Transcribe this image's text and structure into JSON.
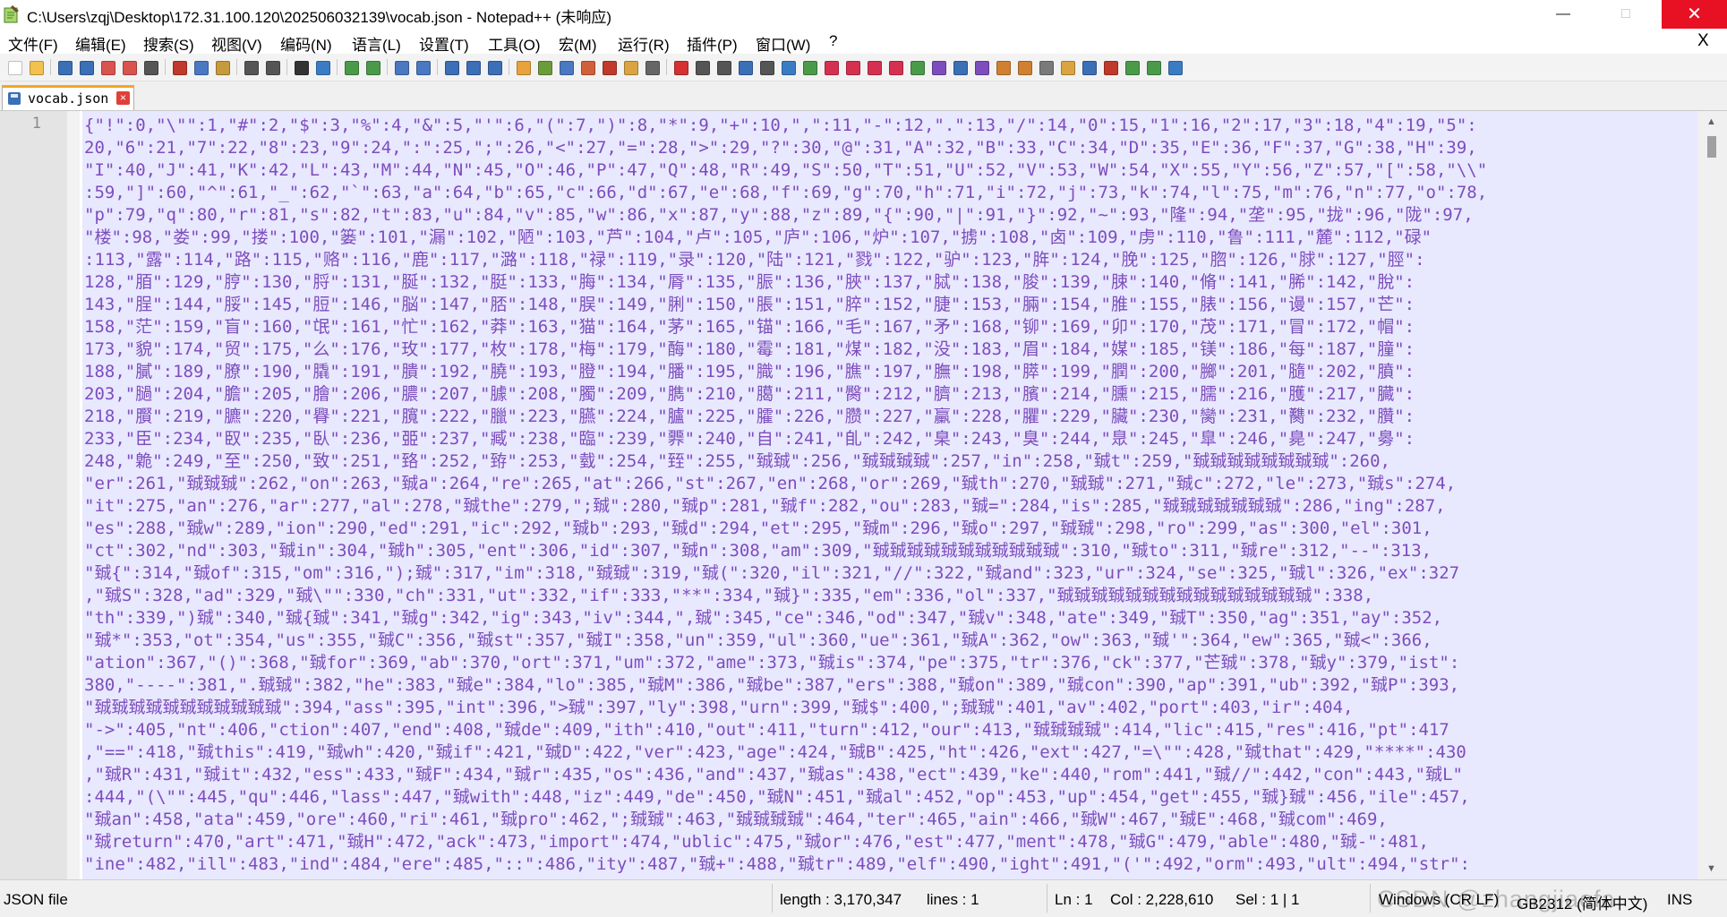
{
  "window": {
    "title": "C:\\Users\\zqj\\Desktop\\172.31.100.120\\202506032139\\vocab.json - Notepad++ (未响应)",
    "minimize_label": "—",
    "maximize_label": "□",
    "close_label": "✕"
  },
  "menu": {
    "items": [
      "文件(F)",
      "编辑(E)",
      "搜索(S)",
      "视图(V)",
      "编码(N)",
      "语言(L)",
      "设置(T)",
      "工具(O)",
      "宏(M)",
      "运行(R)",
      "插件(P)",
      "窗口(W)",
      "?"
    ],
    "close_doc_label": "X"
  },
  "toolbar": {
    "icons": [
      {
        "name": "new-file-icon",
        "color": "#ffffff"
      },
      {
        "name": "open-file-icon",
        "color": "#f2c14e"
      },
      {
        "name": "save-icon",
        "color": "#3b6fb6"
      },
      {
        "name": "save-all-icon",
        "color": "#3b6fb6"
      },
      {
        "name": "close-icon",
        "color": "#d9534f"
      },
      {
        "name": "close-all-icon",
        "color": "#d9534f"
      },
      {
        "name": "print-icon",
        "color": "#555555"
      },
      {
        "name": "cut-icon",
        "color": "#c0392b"
      },
      {
        "name": "copy-icon",
        "color": "#4a78c2"
      },
      {
        "name": "paste-icon",
        "color": "#c79a3b"
      },
      {
        "name": "undo-icon",
        "color": "#555555"
      },
      {
        "name": "redo-icon",
        "color": "#555555"
      },
      {
        "name": "find-icon",
        "color": "#333333"
      },
      {
        "name": "replace-icon",
        "color": "#3a7cc4"
      },
      {
        "name": "zoom-in-icon",
        "color": "#4a9a4a"
      },
      {
        "name": "zoom-out-icon",
        "color": "#4a9a4a"
      },
      {
        "name": "sync-vertical-icon",
        "color": "#4a78c2"
      },
      {
        "name": "sync-horizontal-icon",
        "color": "#4a78c2"
      },
      {
        "name": "word-wrap-icon",
        "color": "#3b6fb6"
      },
      {
        "name": "show-all-chars-icon",
        "color": "#3b6fb6"
      },
      {
        "name": "indent-guide-icon",
        "color": "#3b6fb6"
      },
      {
        "name": "user-lang-icon",
        "color": "#e8a33c"
      },
      {
        "name": "doc-map-icon",
        "color": "#6a9c3a"
      },
      {
        "name": "function-list-icon",
        "color": "#4a78c2"
      },
      {
        "name": "folder-workspace-icon",
        "color": "#d0603a"
      },
      {
        "name": "monitor-icon",
        "color": "#c0392b"
      },
      {
        "name": "open-folder-icon",
        "color": "#d9a441"
      },
      {
        "name": "eye-icon",
        "color": "#666666"
      },
      {
        "name": "record-macro-icon",
        "color": "#d63030"
      },
      {
        "name": "stop-macro-icon",
        "color": "#555555"
      },
      {
        "name": "play-macro-icon",
        "color": "#555555"
      },
      {
        "name": "run-macro-multiple-icon",
        "color": "#3b6fb6"
      },
      {
        "name": "save-macro-icon",
        "color": "#555555"
      },
      {
        "name": "plugin-a-icon",
        "color": "#3a7cc4"
      },
      {
        "name": "plugin-b-icon",
        "color": "#4a9a4a"
      },
      {
        "name": "bookmark-first-icon",
        "color": "#d63050"
      },
      {
        "name": "bookmark-prev-icon",
        "color": "#d63050"
      },
      {
        "name": "bookmark-next-icon",
        "color": "#d63050"
      },
      {
        "name": "bookmark-last-icon",
        "color": "#d63050"
      },
      {
        "name": "plugin-c-icon",
        "color": "#4a9a4a"
      },
      {
        "name": "plugin-d-icon",
        "color": "#7d4dbd"
      },
      {
        "name": "plugin-e-icon",
        "color": "#3b6fb6"
      },
      {
        "name": "plugin-f-icon",
        "color": "#7d4dbd"
      },
      {
        "name": "plugin-g-icon",
        "color": "#d08030"
      },
      {
        "name": "plugin-h-icon",
        "color": "#d08030"
      },
      {
        "name": "plugin-i-icon",
        "color": "#7a7a7a"
      },
      {
        "name": "plugin-j-icon",
        "color": "#d9a441"
      },
      {
        "name": "plugin-k-icon",
        "color": "#3b6fb6"
      },
      {
        "name": "plugin-l-icon",
        "color": "#c0392b"
      },
      {
        "name": "plugin-m-icon",
        "color": "#4a9a4a"
      },
      {
        "name": "plugin-n-icon",
        "color": "#4a9a4a"
      },
      {
        "name": "plugin-o-icon",
        "color": "#3a7cc4"
      }
    ]
  },
  "tab": {
    "label": "vocab.json",
    "close_label": "×"
  },
  "editor": {
    "line_number": "1",
    "lines": [
      "{\"!\":0,\"\\\"\":1,\"#\":2,\"$\":3,\"%\":4,\"&\":5,\"'\":6,\"(\":7,\")\":8,\"*\":9,\"+\":10,\",\":11,\"-\":12,\".\":13,\"/\":14,\"0\":15,\"1\":16,\"2\":17,\"3\":18,\"4\":19,\"5\":",
      "20,\"6\":21,\"7\":22,\"8\":23,\"9\":24,\":\":25,\";\":26,\"<\":27,\"=\":28,\">\":29,\"?\":30,\"@\":31,\"A\":32,\"B\":33,\"C\":34,\"D\":35,\"E\":36,\"F\":37,\"G\":38,\"H\":39,",
      "\"I\":40,\"J\":41,\"K\":42,\"L\":43,\"M\":44,\"N\":45,\"O\":46,\"P\":47,\"Q\":48,\"R\":49,\"S\":50,\"T\":51,\"U\":52,\"V\":53,\"W\":54,\"X\":55,\"Y\":56,\"Z\":57,\"[\":58,\"\\\\\"",
      ":59,\"]\":60,\"^\":61,\"_\":62,\"`\":63,\"a\":64,\"b\":65,\"c\":66,\"d\":67,\"e\":68,\"f\":69,\"g\":70,\"h\":71,\"i\":72,\"j\":73,\"k\":74,\"l\":75,\"m\":76,\"n\":77,\"o\":78,",
      "\"p\":79,\"q\":80,\"r\":81,\"s\":82,\"t\":83,\"u\":84,\"v\":85,\"w\":86,\"x\":87,\"y\":88,\"z\":89,\"{\":90,\"|\":91,\"}\":92,\"~\":93,\"隆\":94,\"垄\":95,\"拢\":96,\"陇\":97,",
      "\"楼\":98,\"娄\":99,\"搂\":100,\"篓\":101,\"漏\":102,\"陋\":103,\"芦\":104,\"卢\":105,\"庐\":106,\"炉\":107,\"掳\":108,\"卤\":109,\"虏\":110,\"鲁\":111,\"麓\":112,\"碌\"",
      ":113,\"露\":114,\"路\":115,\"赂\":116,\"鹿\":117,\"潞\":118,\"禄\":119,\"录\":120,\"陆\":121,\"戮\":122,\"驴\":123,\"脌\":124,\"脕\":125,\"脗\":126,\"脙\":127,\"脛\":",
      "128,\"脜\":129,\"脝\":130,\"脟\":131,\"脠\":132,\"脡\":133,\"脢\":134,\"脣\":135,\"脤\":136,\"脥\":137,\"脦\":138,\"脧\":139,\"脨\":140,\"脩\":141,\"脪\":142,\"脫\":",
      "143,\"脭\":144,\"脮\":145,\"脰\":146,\"脳\":147,\"脴\":148,\"脵\":149,\"脷\":150,\"脹\":151,\"脺\":152,\"脻\":153,\"脼\":154,\"脽\":155,\"脿\":156,\"谩\":157,\"芒\":",
      "158,\"茫\":159,\"盲\":160,\"氓\":161,\"忙\":162,\"莽\":163,\"猫\":164,\"茅\":165,\"锚\":166,\"毛\":167,\"矛\":168,\"铆\":169,\"卯\":170,\"茂\":171,\"冒\":172,\"帽\":",
      "173,\"貌\":174,\"贸\":175,\"么\":176,\"玫\":177,\"枚\":178,\"梅\":179,\"酶\":180,\"霉\":181,\"煤\":182,\"没\":183,\"眉\":184,\"媒\":185,\"镁\":186,\"每\":187,\"膧\":",
      "188,\"膩\":189,\"膫\":190,\"膬\":191,\"膭\":192,\"膮\":193,\"膯\":194,\"膰\":195,\"膱\":196,\"膲\":197,\"膴\":198,\"膵\":199,\"膶\":200,\"膷\":201,\"膸\":202,\"膹\":",
      "203,\"膼\":204,\"膽\":205,\"膾\":206,\"膿\":207,\"臄\":208,\"臅\":209,\"臇\":210,\"臈\":211,\"臋\":212,\"臍\":213,\"臏\":214,\"臐\":215,\"臑\":216,\"臒\":217,\"臓\":",
      "218,\"臔\":219,\"臕\":220,\"臖\":221,\"臗\":222,\"臘\":223,\"臙\":224,\"臚\":225,\"臛\":226,\"臜\":227,\"臝\":228,\"臞\":229,\"臟\":230,\"臠\":231,\"臡\":232,\"臢\":",
      "233,\"臣\":234,\"臤\":235,\"臥\":236,\"臦\":237,\"臧\":238,\"臨\":239,\"臩\":240,\"自\":241,\"臫\":242,\"臬\":243,\"臭\":244,\"臮\":245,\"臯\":246,\"臰\":247,\"臱\":",
      "248,\"臲\":249,\"至\":250,\"致\":251,\"臵\":252,\"臶\":253,\"臷\":254,\"臸\":255,\"臹臹\":256,\"臹臹臹臹\":257,\"in\":258,\"臹t\":259,\"臹臹臹臹臹臹臹臹\":260,",
      "\"er\":261,\"臹臹臹\":262,\"on\":263,\"臹a\":264,\"re\":265,\"at\":266,\"st\":267,\"en\":268,\"or\":269,\"臹th\":270,\"臹臹\":271,\"臹c\":272,\"le\":273,\"臹s\":274,",
      "\"it\":275,\"an\":276,\"ar\":277,\"al\":278,\"臹the\":279,\";臹\":280,\"臹p\":281,\"臹f\":282,\"ou\":283,\"臹=\":284,\"is\":285,\"臹臹臹臹臹臹臹\":286,\"ing\":287,",
      "\"es\":288,\"臹w\":289,\"ion\":290,\"ed\":291,\"ic\":292,\"臹b\":293,\"臹d\":294,\"et\":295,\"臹m\":296,\"臹o\":297,\"臹臹\":298,\"ro\":299,\"as\":300,\"el\":301,",
      "\"ct\":302,\"nd\":303,\"臹in\":304,\"臹h\":305,\"ent\":306,\"id\":307,\"臹n\":308,\"am\":309,\"臹臹臹臹臹臹臹臹臹臹臹\":310,\"臹to\":311,\"臹re\":312,\"--\":313,",
      "\"臹{\":314,\"臹of\":315,\"om\":316,\");臹\":317,\"im\":318,\"臹臹\":319,\"臹(\":320,\"il\":321,\"//\":322,\"臹and\":323,\"ur\":324,\"se\":325,\"臹l\":326,\"ex\":327",
      ",\"臹S\":328,\"ad\":329,\"臹\\\"\":330,\"ch\":331,\"ut\":332,\"if\":333,\"**\":334,\"臹}\":335,\"em\":336,\"ol\":337,\"臹臹臹臹臹臹臹臹臹臹臹臹臹臹臹\":338,",
      "\"th\":339,\")臹\":340,\"臹{臹\":341,\"臹g\":342,\"ig\":343,\"iv\":344,\",臹\":345,\"ce\":346,\"od\":347,\"臹v\":348,\"ate\":349,\"臹T\":350,\"ag\":351,\"ay\":352,",
      "\"臹*\":353,\"ot\":354,\"us\":355,\"臹C\":356,\"臹st\":357,\"臹I\":358,\"un\":359,\"ul\":360,\"ue\":361,\"臹A\":362,\"ow\":363,\"臹'\":364,\"ew\":365,\"臹<\":366,",
      "\"ation\":367,\"()\":368,\"臹for\":369,\"ab\":370,\"ort\":371,\"um\":372,\"ame\":373,\"臹is\":374,\"pe\":375,\"tr\":376,\"ck\":377,\"芒臹\":378,\"臹y\":379,\"ist\":",
      "380,\"----\":381,\".臹臹\":382,\"he\":383,\"臹e\":384,\"lo\":385,\"臹M\":386,\"臹be\":387,\"ers\":388,\"臹on\":389,\"臹con\":390,\"ap\":391,\"ub\":392,\"臹P\":393,",
      "\"臹臹臹臹臹臹臹臹臹臹臹\":394,\"ass\":395,\"int\":396,\">臹\":397,\"ly\":398,\"urn\":399,\"臹$\":400,\";臹臹\":401,\"av\":402,\"port\":403,\"ir\":404,",
      "\"->\":405,\"nt\":406,\"ction\":407,\"end\":408,\"臹de\":409,\"ith\":410,\"out\":411,\"turn\":412,\"our\":413,\"臹臹臹臹\":414,\"lic\":415,\"res\":416,\"pt\":417",
      ",\"==\":418,\"臹this\":419,\"臹wh\":420,\"臹if\":421,\"臹D\":422,\"ver\":423,\"age\":424,\"臹B\":425,\"ht\":426,\"ext\":427,\"=\\\"\":428,\"臹that\":429,\"****\":430",
      ",\"臹R\":431,\"臹it\":432,\"ess\":433,\"臹F\":434,\"臹r\":435,\"os\":436,\"and\":437,\"臹as\":438,\"ect\":439,\"ke\":440,\"rom\":441,\"臹//\":442,\"con\":443,\"臹L\"",
      ":444,\"(\\\"\":445,\"qu\":446,\"lass\":447,\"臹with\":448,\"iz\":449,\"de\":450,\"臹N\":451,\"臹al\":452,\"op\":453,\"up\":454,\"get\":455,\"臹}臹\":456,\"ile\":457,",
      "\"臹an\":458,\"ata\":459,\"ore\":460,\"ri\":461,\"臹pro\":462,\";臹臹\":463,\"臹臹臹臹\":464,\"ter\":465,\"ain\":466,\"臹W\":467,\"臹E\":468,\"臹com\":469,",
      "\"臹return\":470,\"art\":471,\"臹H\":472,\"ack\":473,\"import\":474,\"ublic\":475,\"臹or\":476,\"est\":477,\"ment\":478,\"臹G\":479,\"able\":480,\"臹-\":481,",
      "\"ine\":482,\"ill\":483,\"ind\":484,\"ere\":485,\"::\":486,\"ity\":487,\"臹+\":488,\"臹tr\":489,\"elf\":490,\"ight\":491,\"('\":492,\"orm\":493,\"ult\":494,\"str\":"
    ]
  },
  "status": {
    "file_type": "JSON file",
    "length": "length : 3,170,347",
    "lines": "lines : 1",
    "ln": "Ln : 1",
    "col": "Col : 2,228,610",
    "sel": "Sel : 1 | 1",
    "eol": "Windows (CR LF)",
    "encoding": "GB2312 (简体中文)",
    "ins": "INS",
    "watermark": "CSDN @zhangjiaofa"
  }
}
